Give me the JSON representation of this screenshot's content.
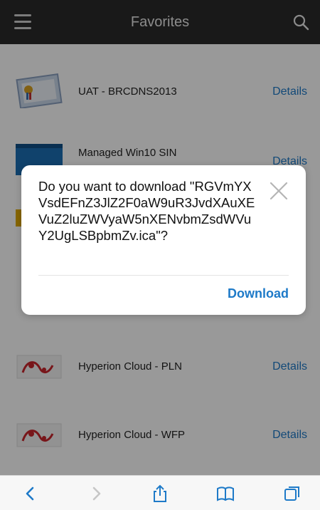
{
  "header": {
    "title": "Favorites"
  },
  "list": {
    "items": [
      {
        "label": "UAT - BRCDNS2013",
        "action": "Details"
      },
      {
        "label": "Managed Win10 SIN",
        "action": "Details"
      },
      {
        "label": "",
        "action": ""
      },
      {
        "label": "",
        "action": ""
      },
      {
        "label": "Hyperion Cloud - PLN",
        "action": "Details"
      },
      {
        "label": "Hyperion Cloud - WFP",
        "action": "Details"
      }
    ]
  },
  "dialog": {
    "message": "Do you want to download \"RGVmYXVsdEFnZ3JlZ2F0aW9uR3JvdXAuXEVuZ2luZWVyaW5nXENvbmZsdWVuY2UgLSBpbmZv.ica\"?",
    "download_label": "Download"
  },
  "colors": {
    "accent": "#1e7ac8",
    "header_bg": "#2b2b2b"
  },
  "toolbar": {
    "icons": [
      "back-icon",
      "forward-icon",
      "share-icon",
      "bookmarks-icon",
      "tabs-icon"
    ]
  }
}
